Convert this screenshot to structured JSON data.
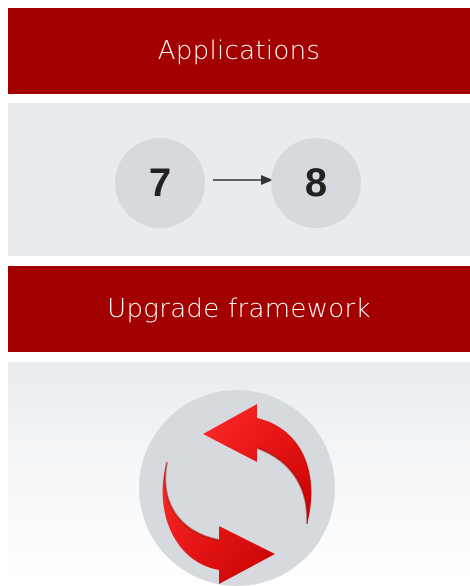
{
  "banners": {
    "applications": "Applications",
    "upgrade": "Upgrade framework"
  },
  "versions": {
    "from": "7",
    "to": "8"
  },
  "icons": {
    "version_arrow": "right-arrow-icon",
    "sync": "sync-arrows-icon"
  },
  "colors": {
    "banner_red": "#a30000",
    "panel_gray": "#e8ecef",
    "circle_gray": "#d6dade",
    "arrow_red": "#e81313"
  }
}
